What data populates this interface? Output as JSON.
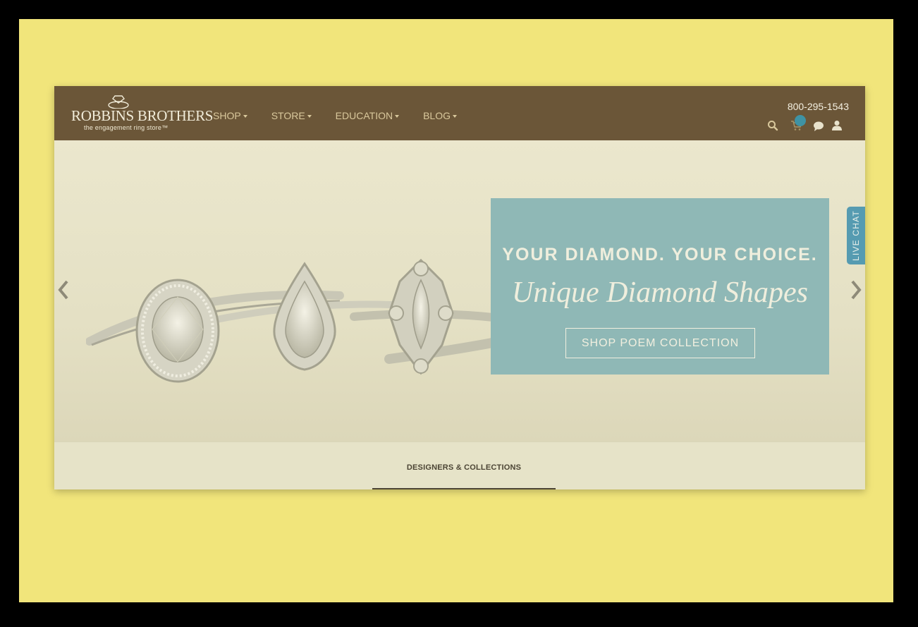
{
  "header": {
    "logo": {
      "brand": "ROBBINS BROTHERS",
      "tagline": "the engagement ring store™"
    },
    "nav": [
      {
        "label": "SHOP"
      },
      {
        "label": "STORE"
      },
      {
        "label": "EDUCATION"
      },
      {
        "label": "BLOG"
      }
    ],
    "phone": "800-295-1543",
    "utility_icons": [
      "search-icon",
      "cart-icon",
      "chat-bubble-icon",
      "user-icon"
    ]
  },
  "hero": {
    "headline": "YOUR DIAMOND. YOUR CHOICE.",
    "subheadline": "Unique Diamond Shapes",
    "cta_label": "SHOP POEM COLLECTION",
    "prev_icon": "chevron-left-icon",
    "next_icon": "chevron-right-icon"
  },
  "live_chat": {
    "label": "LIVE CHAT"
  },
  "tabs": [
    {
      "label": "DESIGNERS & COLLECTIONS",
      "active": true
    }
  ],
  "colors": {
    "background": "#f1e57b",
    "header": "#6b5638",
    "nav_text": "#d9c89c",
    "promo_panel": "#8fb8b6",
    "live_chat": "#569bb1",
    "cart_badge": "#3f93a4"
  }
}
